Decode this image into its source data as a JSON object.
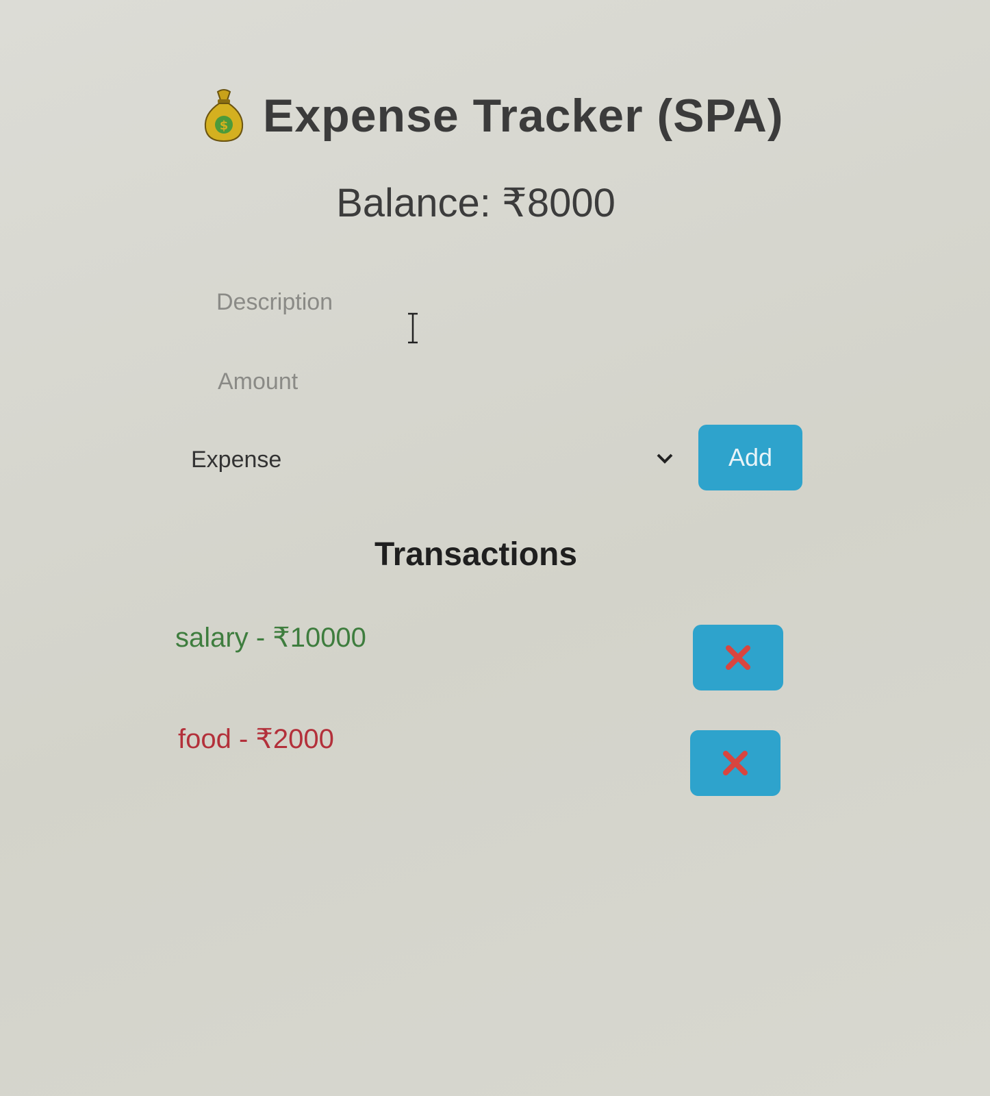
{
  "header": {
    "icon": "money-bag-icon",
    "title": "Expense Tracker (SPA)"
  },
  "balance": {
    "text": "Balance: ₹8000"
  },
  "form": {
    "description_placeholder": "Description",
    "description_value": "",
    "amount_placeholder": "Amount",
    "amount_value": "",
    "type_selected": "Expense",
    "add_label": "Add"
  },
  "transactions": {
    "heading": "Transactions",
    "items": [
      {
        "text": "salary - ₹10000",
        "kind": "income",
        "delete_icon": "cross-mark-icon"
      },
      {
        "text": "food - ₹2000",
        "kind": "expense",
        "delete_icon": "cross-mark-icon"
      }
    ]
  },
  "colors": {
    "accent": "#2ea3cc",
    "income": "#3e7d3e",
    "expense": "#b3303a",
    "delete_mark": "#d8453f"
  }
}
